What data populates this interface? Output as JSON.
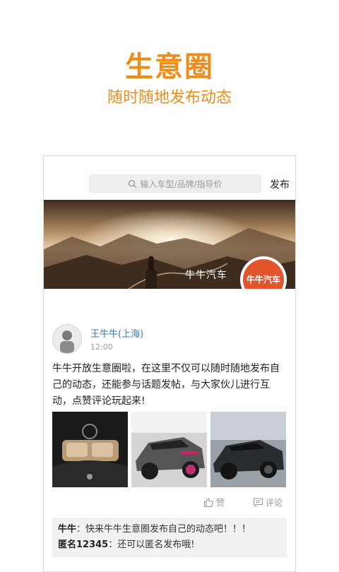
{
  "promo": {
    "title": "生意圈",
    "subtitle": "随时随地发布动态"
  },
  "app": {
    "search": {
      "placeholder": "输入车型/品牌/指导价"
    },
    "publish_label": "发布",
    "banner": {
      "name": "牛牛汽车",
      "logo_text": "牛牛汽车"
    },
    "post": {
      "author": "王牛牛(上海)",
      "time": "12:00",
      "text": "牛牛开放生意圈啦，在这里不仅可以随时随地发布自己的动态，还能参与话题发帖，与大家伙儿进行互动，点赞评论玩起来!",
      "like_label": "赞",
      "comment_label": "评论",
      "comments": [
        {
          "user": "牛牛",
          "sep": "：",
          "text": "快来牛牛生意圈发布自己的动态吧！！！"
        },
        {
          "user": "匿名12345",
          "sep": "：",
          "text": "还可以匿名发布哦!"
        }
      ]
    }
  },
  "colors": {
    "accent": "#f08c18",
    "author_link": "#3b78b8",
    "logo": "#e2542b"
  }
}
